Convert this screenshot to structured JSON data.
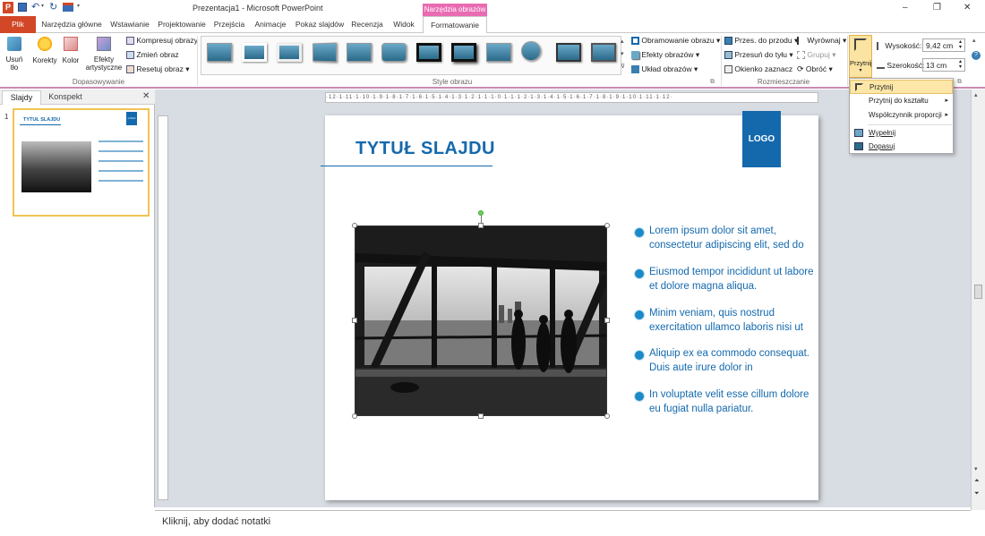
{
  "window": {
    "title": "Prezentacja1 - Microsoft PowerPoint",
    "minimize": "–",
    "restore": "❐",
    "close": "✕"
  },
  "quick_access": {
    "app_icon": "P"
  },
  "context_tab": {
    "label": "Narzędzia obrazów"
  },
  "tabs": [
    "Plik",
    "Narzędzia główne",
    "Wstawianie",
    "Projektowanie",
    "Przejścia",
    "Animacje",
    "Pokaz slajdów",
    "Recenzja",
    "Widok",
    "Formatowanie"
  ],
  "ribbon": {
    "adjust": {
      "remove_bg": [
        "Usuń",
        "tło"
      ],
      "corrections": "Korekty",
      "color": "Kolor",
      "artistic": [
        "Efekty",
        "artystyczne"
      ],
      "compress": "Kompresuj obrazy",
      "change": "Zmień obraz",
      "reset": "Resetuj obraz",
      "group_label": "Dopasowywanie"
    },
    "styles": {
      "group_label": "Style obrazu",
      "border": "Obramowanie obrazu",
      "effects": "Efekty obrazów",
      "layout": "Układ obrazów"
    },
    "arrange": {
      "bring_forward": "Przes. do przodu",
      "send_backward": "Przesuń do tyłu",
      "selection_pane": "Okienko zaznacz",
      "align": "Wyrównaj",
      "group": "Grupuj",
      "rotate": "Obróć",
      "group_label": "Rozmieszczanie"
    },
    "size": {
      "crop": "Przytnij",
      "height_label": "Wysokość:",
      "height_value": "9,42 cm",
      "width_label": "Szerokość:",
      "width_value": "13 cm"
    }
  },
  "crop_menu": {
    "items": [
      "Przytnij",
      "Przytnij do kształtu",
      "Współczynnik proporcji",
      "Wypełnij",
      "Dopasuj"
    ]
  },
  "left_panel": {
    "tab_slides": "Slajdy",
    "tab_outline": "Konspekt",
    "close": "✕",
    "slide_number": "1",
    "thumb_title": "TYTUŁ SLAJDU",
    "thumb_logo": "LOGO"
  },
  "ruler": {
    "horizontal": "·12·1·11·1·10·1·9·1·8·1·7·1·6·1·5·1·4·1·3·1·2·1·1·1·0·1·1·1·2·1·3·1·4·1·5·1·6·1·7·1·8·1·9·1·10·1·11·1·12·"
  },
  "slide": {
    "title": "TYTUŁ SLAJDU",
    "logo": "LOGO",
    "bullets": [
      "Lorem ipsum dolor sit amet, consectetur adipiscing elit, sed do",
      "Eiusmod tempor incididunt ut labore et dolore magna aliqua.",
      "Minim veniam, quis nostrud exercitation ullamco laboris nisi ut",
      "Aliquip ex ea commodo consequat. Duis aute irure dolor in",
      "In voluptate velit esse cillum dolore eu fugiat nulla pariatur."
    ]
  },
  "notes": {
    "placeholder": "Kliknij, aby dodać notatki"
  },
  "colors": {
    "accent": "#1469ad",
    "file_tab": "#d24726",
    "context": "#e96bb2"
  }
}
